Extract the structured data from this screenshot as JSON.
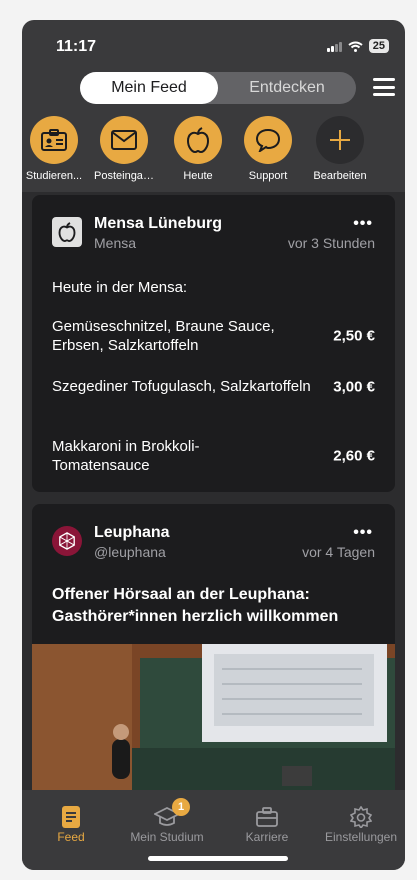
{
  "status": {
    "time": "11:17",
    "battery": "25"
  },
  "segments": {
    "active": "Mein Feed",
    "inactive": "Entdecken"
  },
  "shortcuts": [
    {
      "label": "Studieren...",
      "icon": "id-card-icon"
    },
    {
      "label": "Posteingang",
      "icon": "mail-icon"
    },
    {
      "label": "Heute",
      "icon": "apple-icon"
    },
    {
      "label": "Support",
      "icon": "chat-bubble-icon"
    },
    {
      "label": "Bearbeiten",
      "icon": "plus-icon"
    }
  ],
  "mensa_card": {
    "title": "Mensa Lüneburg",
    "subtitle": "Mensa",
    "time": "vor 3 Stunden",
    "more": "•••",
    "intro": "Heute in der Mensa:",
    "items": [
      {
        "dish": "Gemüseschnitzel, Braune Sauce, Erbsen, Salzkartoffeln",
        "price": "2,50 €"
      },
      {
        "dish": "Szegediner Tofugulasch, Salzkartoffeln",
        "price": "3,00 €"
      },
      {
        "dish": "Makkaroni in Brokkoli-Tomatensauce",
        "price": "2,60 €"
      }
    ]
  },
  "leuphana_card": {
    "title": "Leuphana",
    "subtitle": "@leuphana",
    "time": "vor 4 Tagen",
    "more": "•••",
    "headline": "Offener Hörsaal an der Leuphana: Gasthörer*innen herzlich willkommen"
  },
  "tabs": [
    {
      "label": "Feed",
      "icon": "feed-icon",
      "active": true
    },
    {
      "label": "Mein Studium",
      "icon": "graduation-cap-icon",
      "badge": "1"
    },
    {
      "label": "Karriere",
      "icon": "briefcase-icon"
    },
    {
      "label": "Einstellungen",
      "icon": "gear-icon"
    }
  ],
  "colors": {
    "accent": "#e8a942",
    "background": "#3a3a3c",
    "card": "#1c1c1e"
  }
}
